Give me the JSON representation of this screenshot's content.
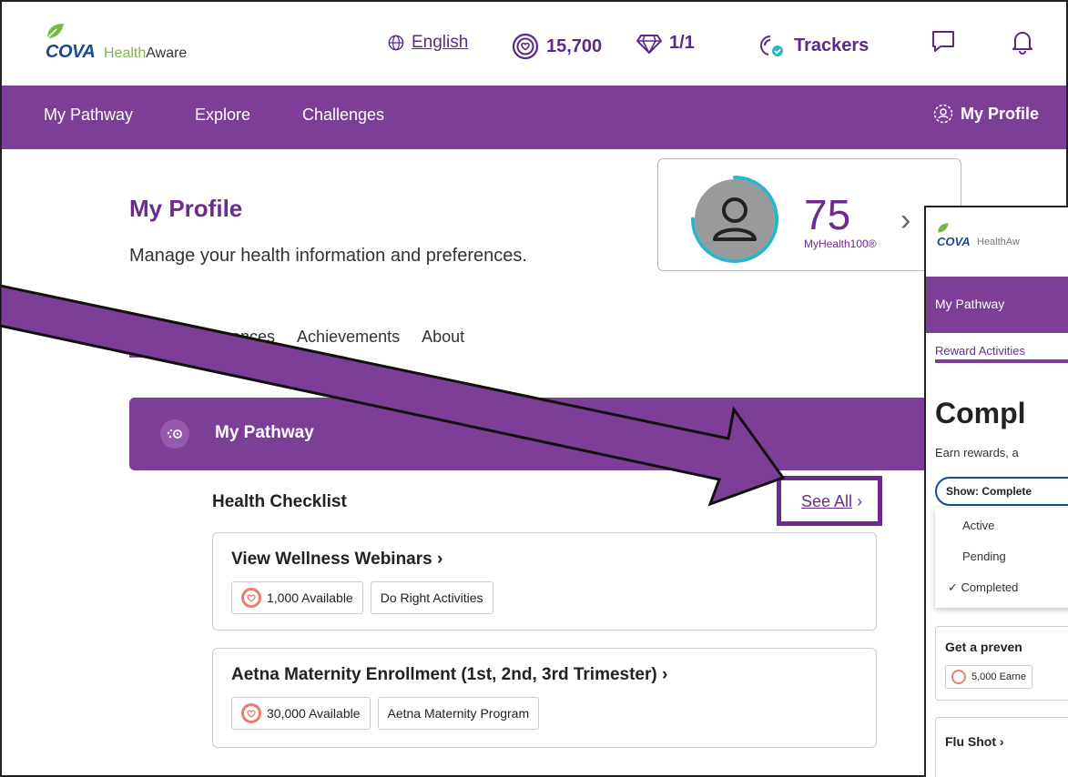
{
  "header": {
    "logo_brand": "COVA",
    "logo_health": "Health",
    "logo_aware": "Aware",
    "language": "English",
    "points": "15,700",
    "gems": "1/1",
    "trackers": "Trackers",
    "icons": [
      "globe-icon",
      "points-coin-icon",
      "diamond-icon",
      "trackers-icon",
      "chat-icon",
      "bell-icon"
    ]
  },
  "nav": {
    "items": [
      "My Pathway",
      "Explore",
      "Challenges"
    ],
    "profile": "My Profile"
  },
  "profile": {
    "title": "My Profile",
    "subtitle": "Manage your health information and preferences.",
    "score": "75",
    "score_label": "MyHealth100®",
    "score_progress": 0.75,
    "tabs": [
      "My",
      "ences",
      "Achievements",
      "About"
    ]
  },
  "pathway": {
    "title": "My Pathway"
  },
  "checklist": {
    "title": "Health Checklist",
    "see_all": "See All",
    "items": [
      {
        "title": "View Wellness Webinars",
        "points": "1,000 Available",
        "tag": "Do Right Activities"
      },
      {
        "title": "Aetna Maternity Enrollment (1st, 2nd, 3rd Trimester)",
        "points": "30,000 Available",
        "tag": "Aetna Maternity Program"
      }
    ]
  },
  "overlay": {
    "logo_brand": "COVA",
    "logo_sub": "HealthAw",
    "nav_item": "My Pathway",
    "sub_tab": "Reward Activities",
    "title": "Compl",
    "desc": "Earn rewards, a",
    "filter": "Show: Complete",
    "menu": [
      "Active",
      "Pending",
      "Completed"
    ],
    "card1_title": "Get a preven",
    "card1_chip": "5,000 Earne",
    "card2_title": "Flu Shot"
  },
  "colors": {
    "brand_purple": "#7c3e96",
    "title_purple": "#6b2c8e",
    "logo_blue": "#1c4a8f",
    "leaf_green": "#7ab648",
    "ring_teal": "#2bb5c8",
    "coin_coral": "#f07b6b"
  }
}
